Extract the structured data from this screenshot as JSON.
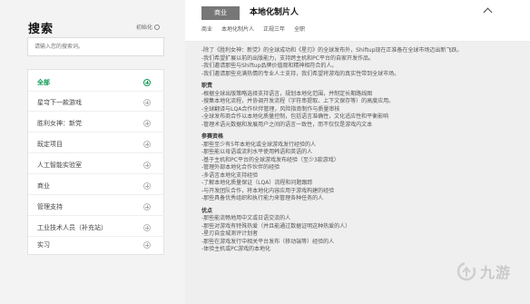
{
  "sidebar": {
    "title": "搜索",
    "reset_label": "初始化",
    "search_placeholder": "请输入您的搜索词。",
    "categories": [
      {
        "label": "全部"
      },
      {
        "label": "星穹下一款游戏"
      },
      {
        "label": "胜利女神：新党"
      },
      {
        "label": "既定项目"
      },
      {
        "label": "人工智能实验室"
      },
      {
        "label": "商业"
      },
      {
        "label": "管理支持"
      },
      {
        "label": "工业技术人员（补充站）"
      },
      {
        "label": "实习"
      }
    ]
  },
  "job": {
    "tag": "商业",
    "title": "本地化制片人",
    "meta": [
      "商业",
      "本地化制片人",
      "正规三年",
      "全职"
    ],
    "intro": [
      "-除了《胜利女神：新党》的全球成功和《星刃》的全球发布外，Shiftup现在正准备在全球市场迈出新飞跃。",
      "-我们希望扩展以前的出版能力，支持跨主机和PC平台的自家开发作品。",
      "-我们邀请那些与Shiftup品牌价值观和精神相符合的人。",
      "-我们邀请那些充满热情的专业人士支持，我们希望将游戏的真实性带到全球市场。"
    ],
    "duties_head": "职责",
    "duties": [
      "-根据全球出版策略选择支持语言，规划本地化范围，并制定长期路线图",
      "-搜集本地化流程，并协调开发流程（字符串提取、上下文保存等）的高度应用。",
      "-全球翻译与LQA合作伙伴管理，风险指南制作与质量审核",
      "-全球发布商合作以本地化质量控制，包括语言准确性，文化适应性和平衡影响",
      "-管理术语元数据和发展用户之间的语言一致性，而不仅仅是游戏内文本"
    ],
    "req_head": "参赛资格",
    "requirements": [
      "-那些至少有5年本地化或全球游戏发行经验的人",
      "-那些能以母语或流利水平使用韩语和英语的人",
      "-基于主机和PC平台的全球游戏发布经验（至少3款游戏）",
      "-管理外部本地化合作伙伴的经验",
      "-多语言本地化支持经验",
      "-了解本地化质量保证（LQA）流程和问题跟踪",
      "-与开发团队合作，将本地化内容应用于游戏构建的经验",
      "-那些具备优秀组织和执行能力来管理各种任务的人"
    ],
    "pref_head": "优点",
    "preferences": [
      "-那些能流畅地用中文或日语交流的人",
      "-那些对游戏有特殊热爱（并且能通过数据证明这种热爱的人）",
      "-星刃自金城测评计划者",
      "-那些在游戏发行中相关平台发布（移动端等）经验的人",
      "-体验主机或PC游戏的本地化"
    ]
  },
  "watermark": {
    "text": "九游"
  },
  "colors": {
    "accent": "#0f9b54",
    "tag_bg": "#777777"
  },
  "icons": {
    "reset": "reset-icon",
    "collapse": "chevron-up-icon",
    "category_expand": "plus-circle-icon"
  }
}
